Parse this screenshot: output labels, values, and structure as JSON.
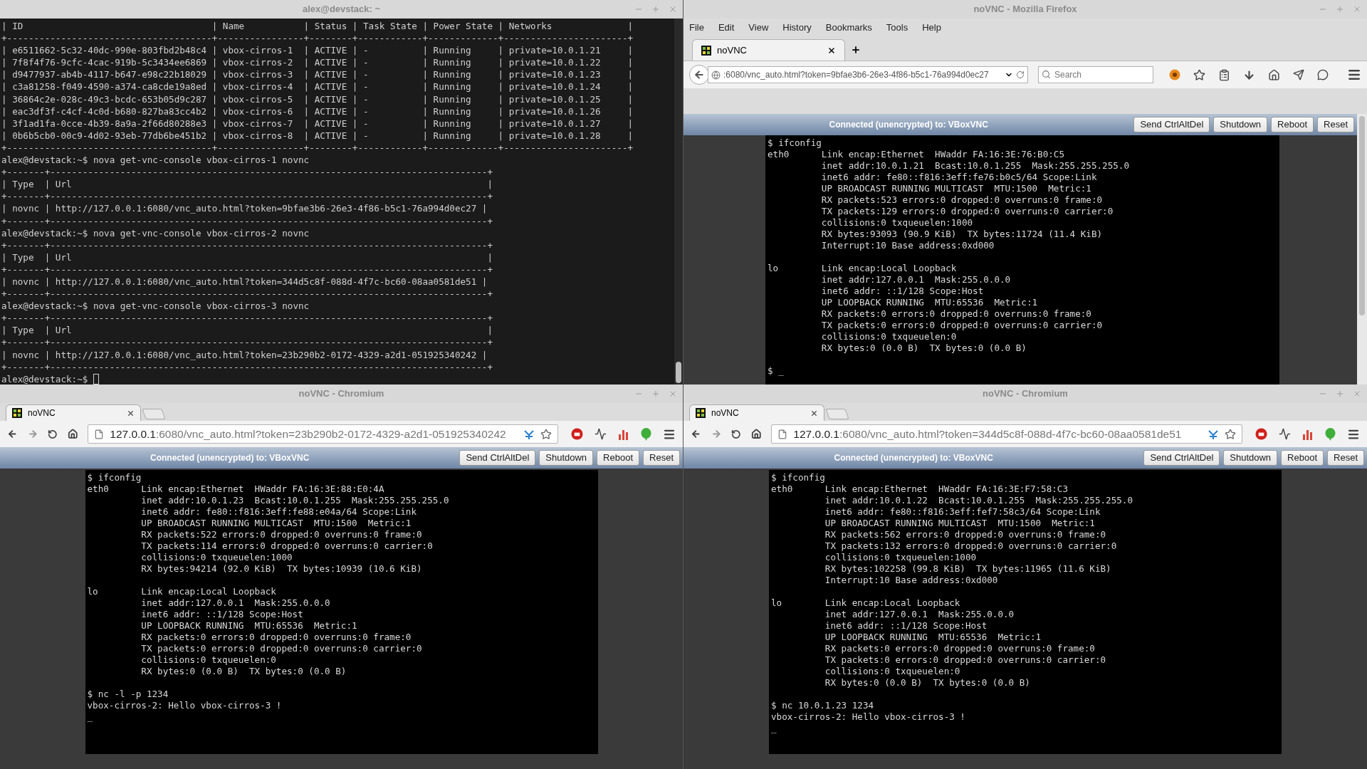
{
  "terminal": {
    "title": "alex@devstack: ~",
    "lines": [
      "| ID                                   | Name           | Status | Task State | Power State | Networks              |",
      "+--------------------------------------+----------------+--------+------------+-------------+-----------------------+",
      "| e6511662-5c32-40dc-990e-803fbd2b48c4 | vbox-cirros-1  | ACTIVE | -          | Running     | private=10.0.1.21     |",
      "| 7f8f4f76-9cfc-4cac-919b-5c3434ee6869 | vbox-cirros-2  | ACTIVE | -          | Running     | private=10.0.1.22     |",
      "| d9477937-ab4b-4117-b647-e98c22b18029 | vbox-cirros-3  | ACTIVE | -          | Running     | private=10.0.1.23     |",
      "| c3a81258-f049-4590-a374-ca8cde19a8ed | vbox-cirros-4  | ACTIVE | -          | Running     | private=10.0.1.24     |",
      "| 36864c2e-028c-49c3-bcdc-653b05d9c287 | vbox-cirros-5  | ACTIVE | -          | Running     | private=10.0.1.25     |",
      "| eac3df3f-c4cf-4c0d-b680-827ba83cc4b2 | vbox-cirros-6  | ACTIVE | -          | Running     | private=10.0.1.26     |",
      "| 3f1ad1fa-0cce-4b39-8a9a-2f66d80288e3 | vbox-cirros-7  | ACTIVE | -          | Running     | private=10.0.1.27     |",
      "| 0b6b5cb0-00c9-4d02-93eb-77db6be451b2 | vbox-cirros-8  | ACTIVE | -          | Running     | private=10.0.1.28     |",
      "+--------------------------------------+----------------+--------+------------+-------------+-----------------------+",
      "alex@devstack:~$ nova get-vnc-console vbox-cirros-1 novnc",
      "+-------+---------------------------------------------------------------------------------+",
      "| Type  | Url                                                                             |",
      "+-------+---------------------------------------------------------------------------------+",
      "| novnc | http://127.0.0.1:6080/vnc_auto.html?token=9bfae3b6-26e3-4f86-b5c1-76a994d0ec27 |",
      "+-------+---------------------------------------------------------------------------------+",
      "alex@devstack:~$ nova get-vnc-console vbox-cirros-2 novnc",
      "+-------+---------------------------------------------------------------------------------+",
      "| Type  | Url                                                                             |",
      "+-------+---------------------------------------------------------------------------------+",
      "| novnc | http://127.0.0.1:6080/vnc_auto.html?token=344d5c8f-088d-4f7c-bc60-08aa0581de51 |",
      "+-------+---------------------------------------------------------------------------------+",
      "alex@devstack:~$ nova get-vnc-console vbox-cirros-3 novnc",
      "+-------+---------------------------------------------------------------------------------+",
      "| Type  | Url                                                                             |",
      "+-------+---------------------------------------------------------------------------------+",
      "| novnc | http://127.0.0.1:6080/vnc_auto.html?token=23b290b2-0172-4329-a2d1-051925340242 |",
      "+-------+---------------------------------------------------------------------------------+"
    ],
    "prompt": "alex@devstack:~$ "
  },
  "firefox": {
    "title": "noVNC - Mozilla Firefox",
    "menu": [
      "File",
      "Edit",
      "View",
      "History",
      "Bookmarks",
      "Tools",
      "Help"
    ],
    "tab_title": "noVNC",
    "url": ":6080/vnc_auto.html?token=9bfae3b6-26e3-4f86-b5c1-76a994d0ec27",
    "search_placeholder": "Search",
    "novnc": {
      "status": "Connected (unencrypted) to: VBoxVNC",
      "buttons": [
        "Send CtrlAltDel",
        "Shutdown",
        "Reboot",
        "Reset"
      ]
    },
    "console": [
      [
        "$ ifconfig",
        "eth0      Link encap:Ethernet  HWaddr FA:16:3E:76:B0:C5",
        "          inet addr:10.0.1.21  Bcast:10.0.1.255  Mask:255.255.255.0",
        "          inet6 addr: fe80::f816:3eff:fe76:b0c5/64 Scope:Link",
        "          UP BROADCAST RUNNING MULTICAST  MTU:1500  Metric:1",
        "          RX packets:523 errors:0 dropped:0 overruns:0 frame:0",
        "          TX packets:129 errors:0 dropped:0 overruns:0 carrier:0",
        "          collisions:0 txqueuelen:1000",
        "          RX bytes:93093 (90.9 KiB)  TX bytes:11724 (11.4 KiB)",
        "          Interrupt:10 Base address:0xd000"
      ],
      [
        "lo        Link encap:Local Loopback",
        "          inet addr:127.0.0.1  Mask:255.0.0.0",
        "          inet6 addr: ::1/128 Scope:Host",
        "          UP LOOPBACK RUNNING  MTU:65536  Metric:1",
        "          RX packets:0 errors:0 dropped:0 overruns:0 frame:0",
        "          TX packets:0 errors:0 dropped:0 overruns:0 carrier:0",
        "          collisions:0 txqueuelen:0",
        "          RX bytes:0 (0.0 B)  TX bytes:0 (0.0 B)"
      ],
      [
        "$ _"
      ]
    ]
  },
  "chromium_windows": [
    {
      "title": "noVNC - Chromium",
      "tab_title": "noVNC",
      "url_host": "127.0.0.1",
      "url_rest": ":6080/vnc_auto.html?token=23b290b2-0172-4329-a2d1-051925340242",
      "novnc": {
        "status": "Connected (unencrypted) to: VBoxVNC",
        "buttons": [
          "Send CtrlAltDel",
          "Shutdown",
          "Reboot",
          "Reset"
        ]
      },
      "console": [
        [
          "$ ifconfig",
          "eth0      Link encap:Ethernet  HWaddr FA:16:3E:88:E0:4A",
          "          inet addr:10.0.1.23  Bcast:10.0.1.255  Mask:255.255.255.0",
          "          inet6 addr: fe80::f816:3eff:fe88:e04a/64 Scope:Link",
          "          UP BROADCAST RUNNING MULTICAST  MTU:1500  Metric:1",
          "          RX packets:522 errors:0 dropped:0 overruns:0 frame:0",
          "          TX packets:114 errors:0 dropped:0 overruns:0 carrier:0",
          "          collisions:0 txqueuelen:1000",
          "          RX bytes:94214 (92.0 KiB)  TX bytes:10939 (10.6 KiB)"
        ],
        [
          "lo        Link encap:Local Loopback",
          "          inet addr:127.0.0.1  Mask:255.0.0.0",
          "          inet6 addr: ::1/128 Scope:Host",
          "          UP LOOPBACK RUNNING  MTU:65536  Metric:1",
          "          RX packets:0 errors:0 dropped:0 overruns:0 frame:0",
          "          TX packets:0 errors:0 dropped:0 overruns:0 carrier:0",
          "          collisions:0 txqueuelen:0",
          "          RX bytes:0 (0.0 B)  TX bytes:0 (0.0 B)"
        ],
        [
          "$ nc -l -p 1234",
          "vbox-cirros-2: Hello vbox-cirros-3 !",
          "_"
        ]
      ]
    },
    {
      "title": "noVNC - Chromium",
      "tab_title": "noVNC",
      "url_host": "127.0.0.1",
      "url_rest": ":6080/vnc_auto.html?token=344d5c8f-088d-4f7c-bc60-08aa0581de51",
      "novnc": {
        "status": "Connected (unencrypted) to: VBoxVNC",
        "buttons": [
          "Send CtrlAltDel",
          "Shutdown",
          "Reboot",
          "Reset"
        ]
      },
      "console": [
        [
          "$ ifconfig",
          "eth0      Link encap:Ethernet  HWaddr FA:16:3E:F7:58:C3",
          "          inet addr:10.0.1.22  Bcast:10.0.1.255  Mask:255.255.255.0",
          "          inet6 addr: fe80::f816:3eff:fef7:58c3/64 Scope:Link",
          "          UP BROADCAST RUNNING MULTICAST  MTU:1500  Metric:1",
          "          RX packets:562 errors:0 dropped:0 overruns:0 frame:0",
          "          TX packets:132 errors:0 dropped:0 overruns:0 carrier:0",
          "          collisions:0 txqueuelen:1000",
          "          RX bytes:102258 (99.8 KiB)  TX bytes:11965 (11.6 KiB)",
          "          Interrupt:10 Base address:0xd000"
        ],
        [
          "lo        Link encap:Local Loopback",
          "          inet addr:127.0.0.1  Mask:255.0.0.0",
          "          inet6 addr: ::1/128 Scope:Host",
          "          UP LOOPBACK RUNNING  MTU:65536  Metric:1",
          "          RX packets:0 errors:0 dropped:0 overruns:0 frame:0",
          "          TX packets:0 errors:0 dropped:0 overruns:0 carrier:0",
          "          collisions:0 txqueuelen:0",
          "          RX bytes:0 (0.0 B)  TX bytes:0 (0.0 B)"
        ],
        [
          "$ nc 10.0.1.23 1234",
          "vbox-cirros-2: Hello vbox-cirros-3 !",
          "_"
        ]
      ]
    }
  ]
}
